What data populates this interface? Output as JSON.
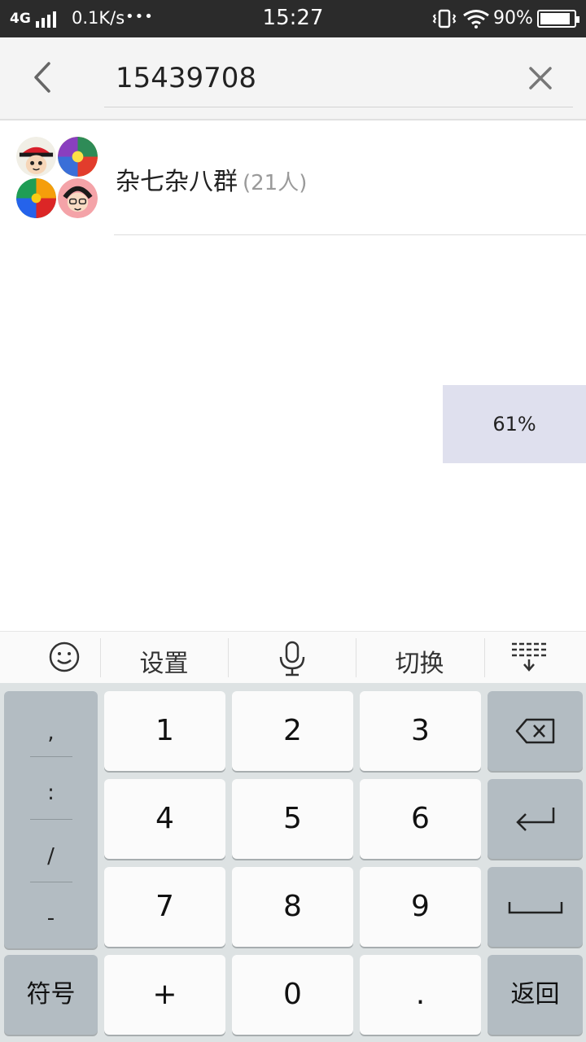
{
  "status_bar": {
    "network": "4G",
    "speed": "0.1K/s",
    "dots": "•••",
    "time": "15:27",
    "battery_text": "90%",
    "battery_level": 0.9
  },
  "search": {
    "query": "15439708"
  },
  "result": {
    "name": "杂七杂八群",
    "count": "(21人)"
  },
  "progress": {
    "text": "61%"
  },
  "keyboard": {
    "toolbar": {
      "settings": "设置",
      "switch": "切换"
    },
    "symbols": [
      ",",
      ":",
      "/",
      "-"
    ],
    "digits": {
      "k1": "1",
      "k2": "2",
      "k3": "3",
      "k4": "4",
      "k5": "5",
      "k6": "6",
      "k7": "7",
      "k8": "8",
      "k9": "9",
      "plus": "+",
      "k0": "0",
      "dot": "."
    },
    "symbol_key": "符号",
    "return_key": "返回"
  },
  "icons": {
    "back": "chevron-left-icon",
    "clear": "close-icon",
    "emoji": "emoji-icon",
    "mic": "microphone-icon",
    "hide": "keyboard-hide-icon",
    "backspace": "backspace-icon",
    "enter": "enter-icon",
    "space": "space-icon"
  }
}
